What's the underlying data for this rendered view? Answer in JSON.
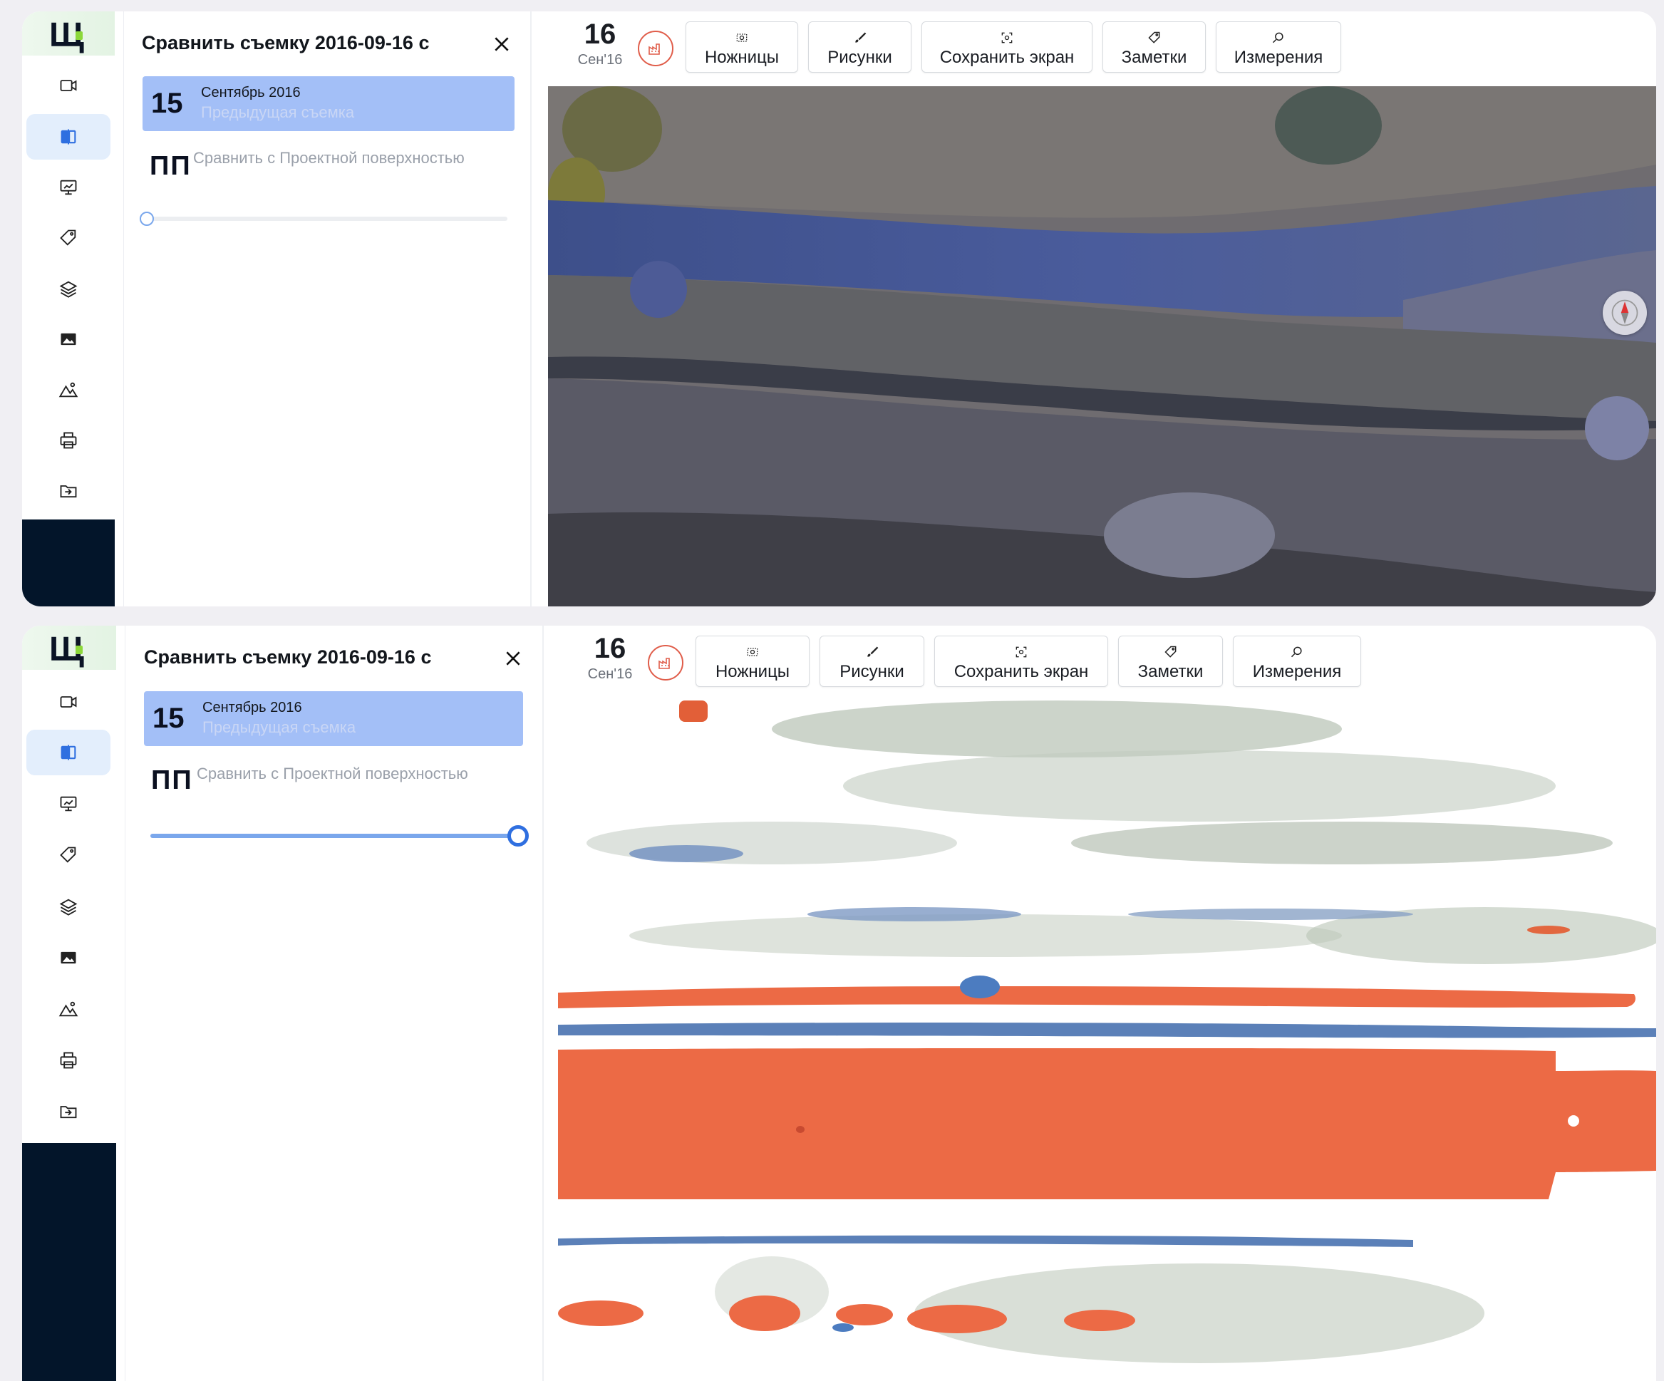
{
  "top": {
    "panel": {
      "title": "Сравнить съемку 2016-09-16 с",
      "card": {
        "day": "15",
        "month": "Сентябрь 2016",
        "subtitle": "Предыдущая съемка"
      },
      "design": {
        "abbr": "ПП",
        "label": "Сравнить с Проектной поверхностью"
      },
      "slider_value": 0
    },
    "toolbar": {
      "date_day": "16",
      "date_month": "Сен'16",
      "buttons": [
        "Ножницы",
        "Рисунки",
        "Сохранить экран",
        "Заметки",
        "Измерения"
      ]
    },
    "map_mode": "orthophoto"
  },
  "bottom": {
    "panel": {
      "title": "Сравнить съемку 2016-09-16 с",
      "card": {
        "day": "15",
        "month": "Сентябрь 2016",
        "subtitle": "Предыдущая съемка"
      },
      "design": {
        "abbr": "ПП",
        "label": "Сравнить с Проектной поверхностью"
      },
      "slider_value": 1
    },
    "toolbar": {
      "date_day": "16",
      "date_month": "Сен'16",
      "buttons": [
        "Ножницы",
        "Рисунки",
        "Сохранить экран",
        "Заметки",
        "Измерения"
      ]
    },
    "map_mode": "difference-heatmap"
  },
  "sidebar_icons": [
    "video-icon",
    "compare-icon",
    "presentation-icon",
    "tag-icon",
    "layers-icon",
    "image-icon",
    "terrain-icon",
    "print-icon",
    "import-icon"
  ],
  "colors": {
    "accent": "#a3bff7",
    "slider": "#7aa7ec",
    "fill_gain": "#ec6a45",
    "cut_loss": "#5b80b8",
    "rail_dark": "#03152a"
  }
}
